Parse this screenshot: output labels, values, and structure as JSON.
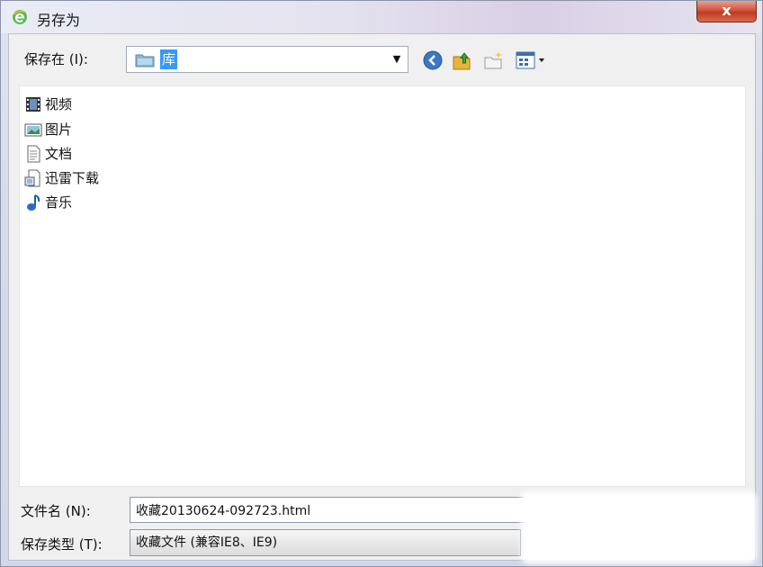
{
  "window": {
    "title": "另存为",
    "close_label": "x"
  },
  "save_in": {
    "label": "保存在 (I):",
    "value": "库"
  },
  "toolbar": {
    "back_icon": "back-arrow-icon",
    "up_icon": "up-folder-icon",
    "new_folder_icon": "new-folder-icon",
    "view_icon": "view-menu-icon"
  },
  "files": [
    {
      "label": "视频",
      "icon": "video-library-icon"
    },
    {
      "label": "图片",
      "icon": "picture-library-icon"
    },
    {
      "label": "文档",
      "icon": "document-library-icon"
    },
    {
      "label": "迅雷下载",
      "icon": "download-library-icon"
    },
    {
      "label": "音乐",
      "icon": "music-library-icon"
    }
  ],
  "filename": {
    "label": "文件名 (N):",
    "value": "收藏20130624-092723.html"
  },
  "filetype": {
    "label": "保存类型 (T):",
    "value": "收藏文件 (兼容IE8、IE9)"
  },
  "colors": {
    "selection": "#3399ff",
    "close_button": "#c03a22",
    "ie_logo": "#5cb85c"
  }
}
